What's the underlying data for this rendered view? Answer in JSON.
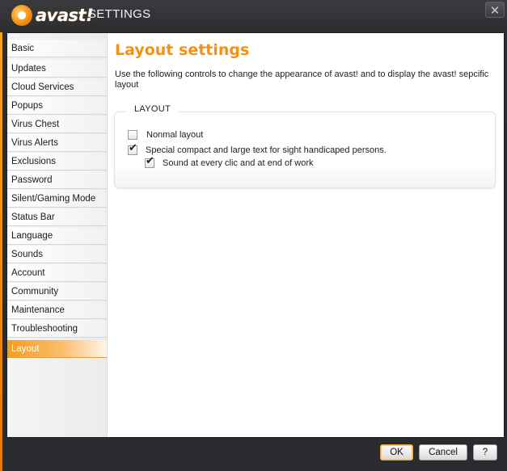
{
  "window": {
    "brand": "avast!",
    "title": "SETTINGS",
    "close_label": "✕"
  },
  "sidebar": {
    "items": [
      {
        "label": "Basic",
        "active": false
      },
      {
        "label": "Updates",
        "active": false
      },
      {
        "label": "Cloud Services",
        "active": false
      },
      {
        "label": "Popups",
        "active": false
      },
      {
        "label": "Virus Chest",
        "active": false
      },
      {
        "label": "Virus Alerts",
        "active": false
      },
      {
        "label": "Exclusions",
        "active": false
      },
      {
        "label": "Password",
        "active": false
      },
      {
        "label": "Silent/Gaming Mode",
        "active": false
      },
      {
        "label": "Status Bar",
        "active": false
      },
      {
        "label": "Language",
        "active": false
      },
      {
        "label": "Sounds",
        "active": false
      },
      {
        "label": "Account",
        "active": false
      },
      {
        "label": "Community",
        "active": false
      },
      {
        "label": "Maintenance",
        "active": false
      },
      {
        "label": "Troubleshooting",
        "active": false
      },
      {
        "label": "Layout",
        "active": true
      }
    ]
  },
  "main": {
    "title": "Layout settings",
    "description": "Use the following controls to change the appearance of avast! and to display the avast! sepcific layout",
    "group": {
      "legend": "LAYOUT",
      "options": [
        {
          "label": "Nonmal  layout",
          "checked": false
        },
        {
          "label": "Special compact and large text for sight handicaped persons.",
          "checked": true
        },
        {
          "label": "Sound at every clic and at end of work",
          "checked": true
        }
      ]
    }
  },
  "footer": {
    "ok_label": "OK",
    "cancel_label": "Cancel",
    "help_label": "?"
  },
  "colors": {
    "accent": "#f39112",
    "titlebar": "#2c2d30",
    "panel": "#ffffff"
  }
}
